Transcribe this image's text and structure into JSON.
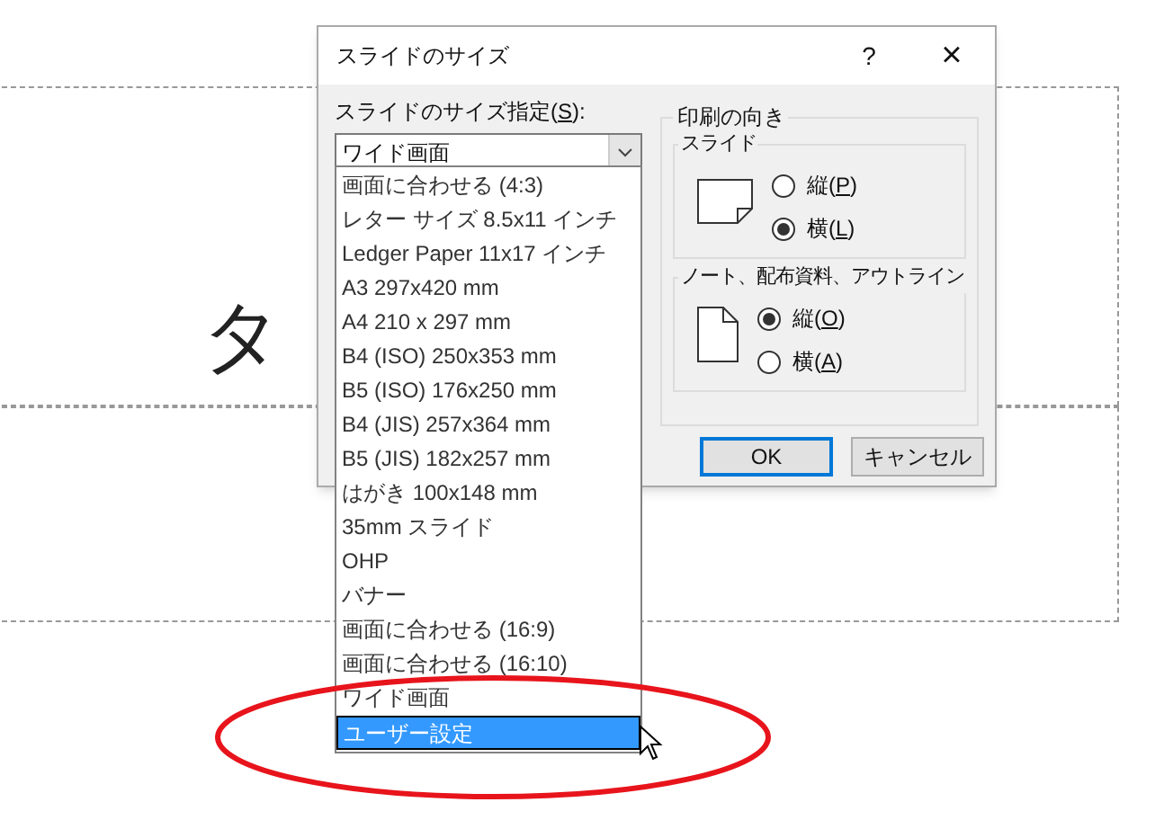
{
  "slide": {
    "title_fragment": "タ"
  },
  "dialog": {
    "title": "スライドのサイズ",
    "help": "?",
    "close": "×",
    "size_label": [
      "スライドのサイズ指定(",
      "S",
      "):"
    ],
    "size_combo": {
      "value": "ワイド画面",
      "expanded": true
    },
    "size_options": [
      {
        "label": "画面に合わせる (4:3)",
        "selected": false
      },
      {
        "label": "レター サイズ 8.5x11 インチ",
        "selected": false
      },
      {
        "label": "Ledger Paper 11x17 インチ",
        "selected": false
      },
      {
        "label": "A3 297x420 mm",
        "selected": false
      },
      {
        "label": "A4 210 x 297 mm",
        "selected": false
      },
      {
        "label": "B4 (ISO) 250x353 mm",
        "selected": false
      },
      {
        "label": "B5 (ISO) 176x250 mm",
        "selected": false
      },
      {
        "label": "B4 (JIS) 257x364 mm",
        "selected": false
      },
      {
        "label": "B5 (JIS) 182x257 mm",
        "selected": false
      },
      {
        "label": "はがき 100x148 mm",
        "selected": false
      },
      {
        "label": "35mm スライド",
        "selected": false
      },
      {
        "label": "OHP",
        "selected": false
      },
      {
        "label": "バナー",
        "selected": false
      },
      {
        "label": "画面に合わせる (16:9)",
        "selected": false
      },
      {
        "label": "画面に合わせる (16:10)",
        "selected": false
      },
      {
        "label": "ワイド画面",
        "selected": false
      },
      {
        "label": "ユーザー設定",
        "selected": true
      }
    ],
    "orientation": {
      "title": "印刷の向き",
      "groups": [
        {
          "title": "スライド",
          "kind": "landscape",
          "options": [
            {
              "label": [
                "縦(",
                "P",
                ")"
              ],
              "selected": false
            },
            {
              "label": [
                "横(",
                "L",
                ")"
              ],
              "selected": true
            }
          ]
        },
        {
          "title": "ノート、配布資料、アウトライン",
          "kind": "portrait",
          "options": [
            {
              "label": [
                "縦(",
                "O",
                ")"
              ],
              "selected": true
            },
            {
              "label": [
                "横(",
                "A",
                ")"
              ],
              "selected": false
            }
          ]
        }
      ]
    },
    "buttons": [
      {
        "label": "OK",
        "default": true
      },
      {
        "label": "キャンセル",
        "default": false
      }
    ]
  }
}
